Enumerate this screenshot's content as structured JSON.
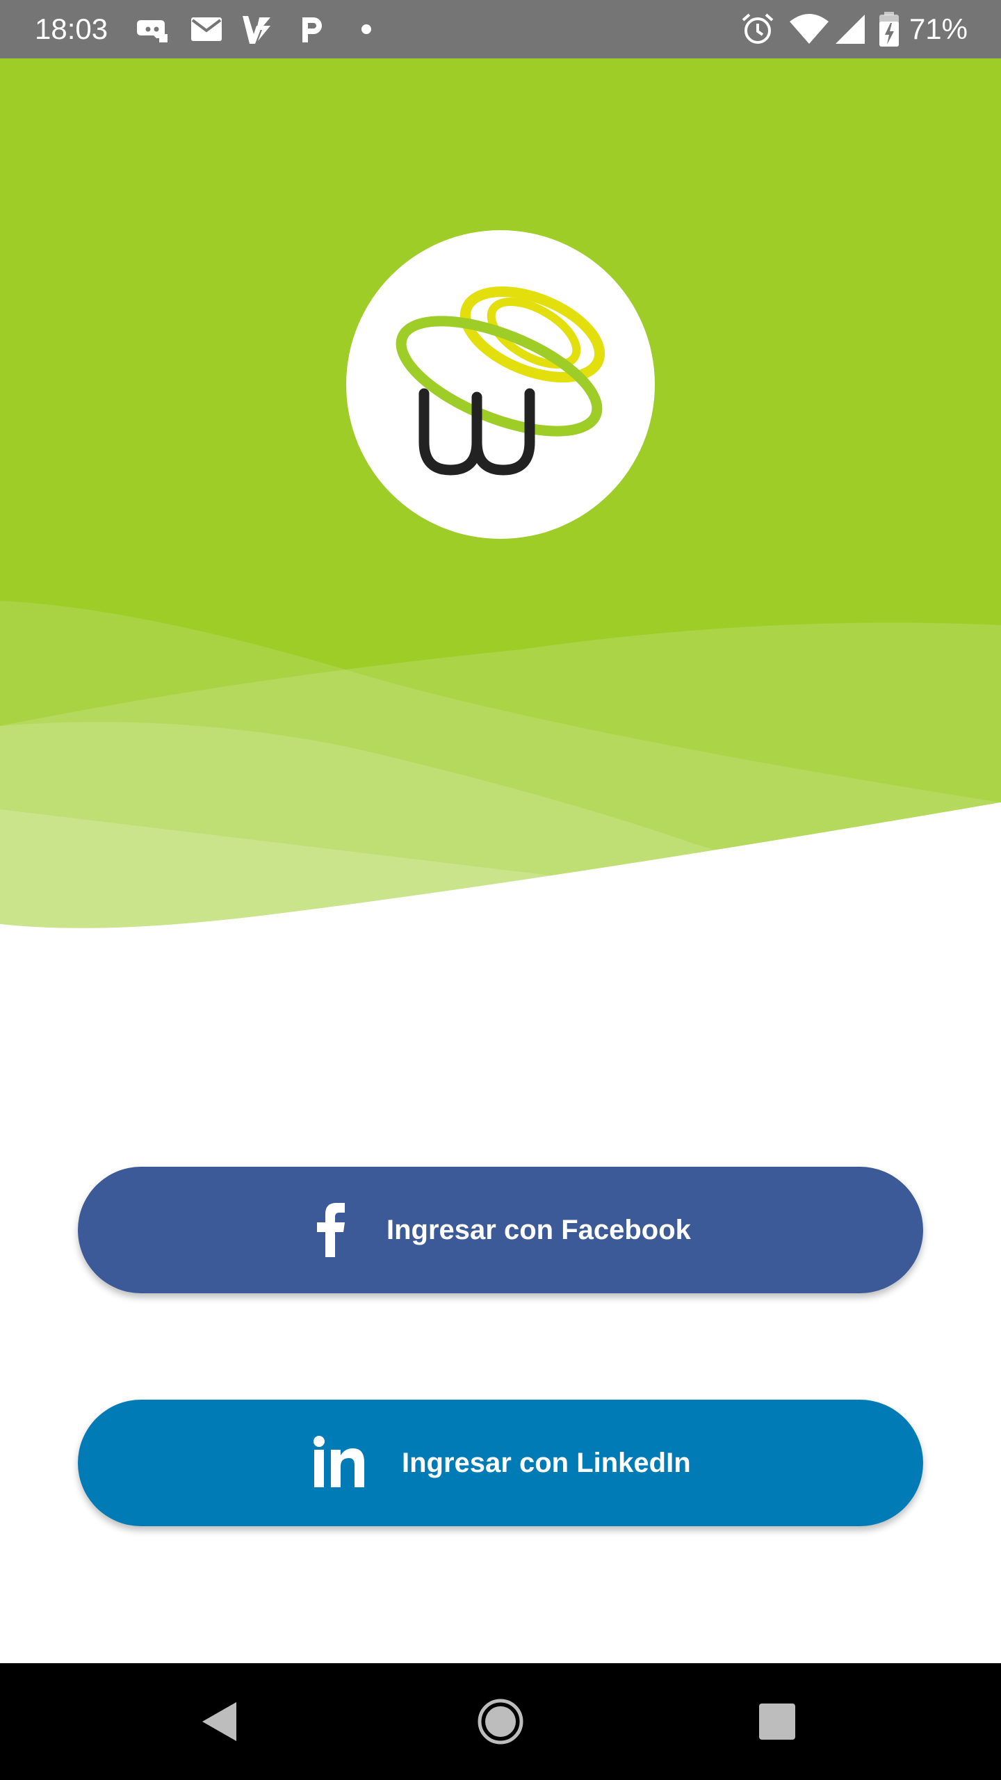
{
  "status_bar": {
    "time": "18:03",
    "battery_percent": "71%",
    "left_icons": [
      "discord-icon",
      "gmail-icon",
      "vlc-icon",
      "parking-icon",
      "dot-icon"
    ],
    "right_icons": [
      "alarm-icon",
      "wifi-icon",
      "signal-icon",
      "battery-charging-icon"
    ]
  },
  "colors": {
    "hero_green": "#9ecd28",
    "facebook_blue": "#3c5a98",
    "linkedin_blue": "#007bb6",
    "logo_yellow": "#e2df0c",
    "logo_green": "#9ecd28",
    "logo_dark": "#222222"
  },
  "logo": {
    "icon": "app-logo-w-icon"
  },
  "buttons": {
    "facebook": {
      "label": "Ingresar con Facebook",
      "icon": "facebook-icon"
    },
    "linkedin": {
      "label": "Ingresar con LinkedIn",
      "icon": "linkedin-icon"
    }
  },
  "nav_bar": {
    "items": [
      "back-icon",
      "home-icon",
      "recents-icon"
    ]
  }
}
